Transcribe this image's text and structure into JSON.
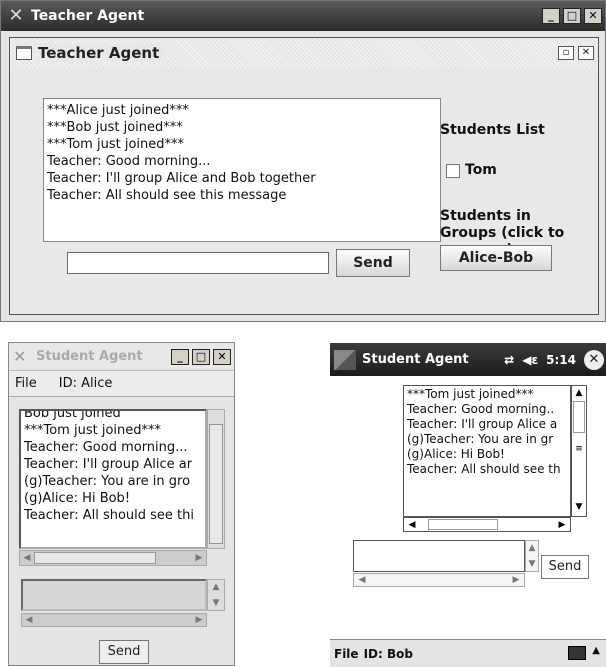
{
  "teacher": {
    "window_title": "Teacher Agent",
    "frame_title": "Teacher Agent",
    "chat_lines": [
      "***Alice just joined***",
      "***Bob just joined***",
      "***Tom just joined***",
      "Teacher: Good morning...",
      "Teacher: I'll group Alice and Bob together",
      "Teacher: All should see this message"
    ],
    "message_input": "",
    "send_label": "Send",
    "students_list_label": "Students List",
    "students": [
      "Tom"
    ],
    "groups_label": "Students in Groups (click to ungroup)",
    "groups": [
      "Alice-Bob"
    ]
  },
  "student_desktop": {
    "window_title": "Student Agent",
    "menu_file": "File",
    "menu_id": "ID: Alice",
    "chat_lines": [
      "Bob just joined",
      "***Tom just joined***",
      "Teacher: Good morning...",
      "Teacher: I'll group Alice ar",
      "(g)Teacher: You are in gro",
      "(g)Alice: Hi Bob!",
      "Teacher: All should see thi"
    ],
    "send_label": "Send"
  },
  "student_pda": {
    "title": "Student Agent",
    "time": "5:14",
    "chat_lines": [
      "***Tom just joined***",
      "Teacher: Good morning..",
      "Teacher: I'll group Alice a",
      "(g)Teacher: You are in gr",
      "(g)Alice: Hi Bob!",
      "Teacher: All should see th"
    ],
    "send_label": "Send",
    "menu_file": "File",
    "menu_id": "ID: Bob"
  }
}
